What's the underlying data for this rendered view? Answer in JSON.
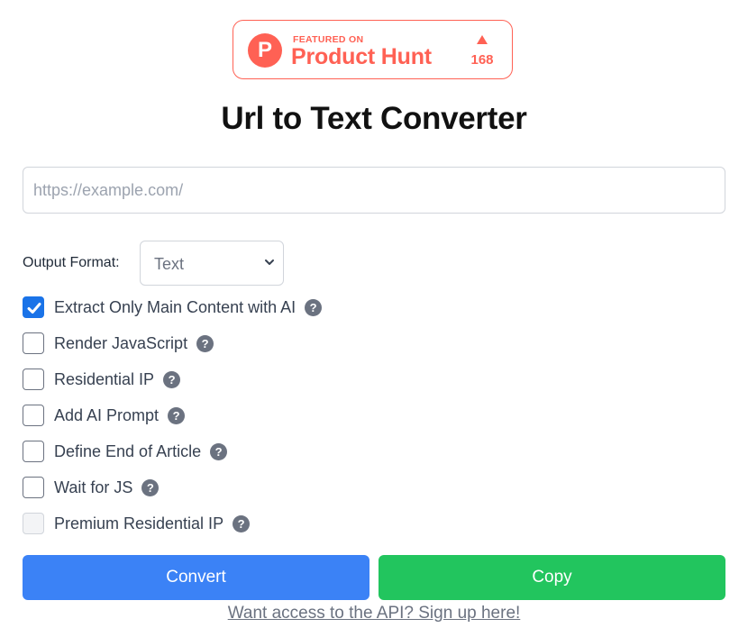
{
  "badge": {
    "logo_letter": "P",
    "featured_text": "FEATURED ON",
    "name": "Product Hunt",
    "upvote_icon": "triangle-up-icon",
    "count": "168",
    "color": "#ff6154"
  },
  "page": {
    "title": "Url to Text Converter"
  },
  "url_input": {
    "value": "",
    "placeholder": "https://example.com/"
  },
  "output_format": {
    "label": "Output Format:",
    "selected": "Text"
  },
  "options": [
    {
      "label": "Extract Only Main Content with AI",
      "checked": true,
      "disabled": false,
      "help": "?"
    },
    {
      "label": "Render JavaScript",
      "checked": false,
      "disabled": false,
      "help": "?"
    },
    {
      "label": "Residential IP",
      "checked": false,
      "disabled": false,
      "help": "?"
    },
    {
      "label": "Add AI Prompt",
      "checked": false,
      "disabled": false,
      "help": "?"
    },
    {
      "label": "Define End of Article",
      "checked": false,
      "disabled": false,
      "help": "?"
    },
    {
      "label": "Wait for JS",
      "checked": false,
      "disabled": false,
      "help": "?"
    },
    {
      "label": "Premium Residential IP",
      "checked": false,
      "disabled": true,
      "help": "?"
    }
  ],
  "buttons": {
    "convert": "Convert",
    "copy": "Copy",
    "convert_color": "#3b82f6",
    "copy_color": "#22c55e"
  },
  "api_link": "Want access to the API? Sign up here!"
}
